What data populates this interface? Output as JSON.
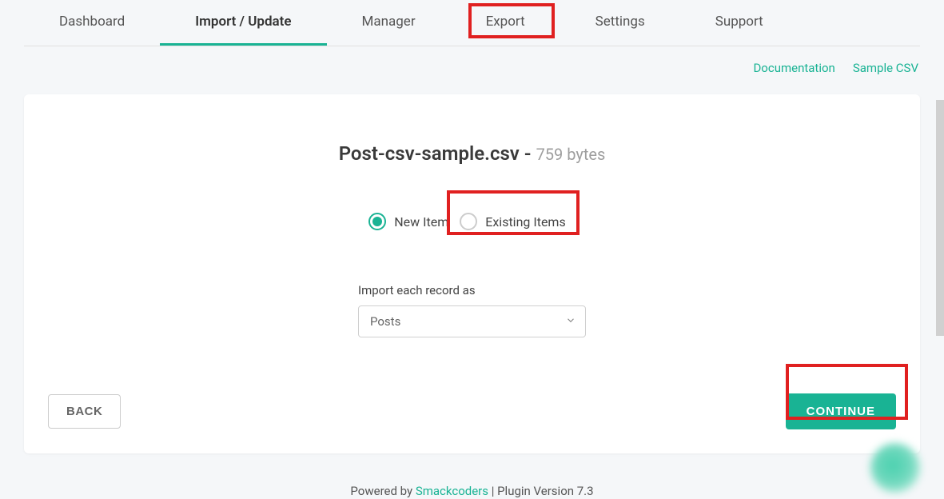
{
  "nav": {
    "tabs": [
      {
        "label": "Dashboard",
        "active": false
      },
      {
        "label": "Import / Update",
        "active": true
      },
      {
        "label": "Manager",
        "active": false
      },
      {
        "label": "Export",
        "active": false
      },
      {
        "label": "Settings",
        "active": false
      },
      {
        "label": "Support",
        "active": false
      }
    ]
  },
  "top_links": {
    "documentation": "Documentation",
    "sample_csv": "Sample CSV"
  },
  "file": {
    "name": "Post-csv-sample.csv",
    "separator": " - ",
    "size": "759 bytes"
  },
  "radios": {
    "new_item": "New Item",
    "existing_items": "Existing Items"
  },
  "form": {
    "import_label": "Import each record as",
    "select_value": "Posts"
  },
  "buttons": {
    "back": "BACK",
    "continue": "CONTINUE"
  },
  "footer": {
    "prefix": "Powered by ",
    "brand": "Smackcoders",
    "suffix": " | Plugin Version 7.3"
  },
  "colors": {
    "accent": "#19b394",
    "highlight": "#e02020"
  }
}
